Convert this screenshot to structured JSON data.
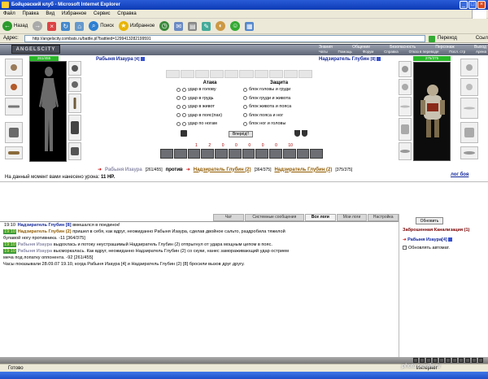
{
  "window": {
    "title": "Бойцовский клуб - Microsoft Internet Explorer"
  },
  "menu": [
    "Файл",
    "Правка",
    "Вид",
    "Избранное",
    "Сервис",
    "Справка"
  ],
  "toolbar": {
    "back": "Назад",
    "search": "Поиск",
    "favorites": "Избранное"
  },
  "address": {
    "label": "Адрес:",
    "url": "http://angelscity.combats.ru/battle.pl?battleid=1299413282199591",
    "go": "Переход",
    "links": "Ссылки"
  },
  "game": {
    "logo": "ANGELSCITY",
    "nav": [
      "Знания",
      "Общение",
      "Безопасность",
      "Персонаж",
      "Выход"
    ],
    "subnav": [
      "Чаты",
      "Помощь",
      "Форум",
      "Справка",
      "Отказ в переводе",
      "Посл. стр",
      "Арена"
    ]
  },
  "left_char": {
    "name": "Рабыня Изаура",
    "level": "[4]",
    "hp_current": "261",
    "hp_max": "455"
  },
  "right_char": {
    "name": "Надзиратель Глубин",
    "level": "[8]",
    "hp_current": "275",
    "hp_max": "375"
  },
  "combat": {
    "attack_head": "Атака",
    "defense_head": "Защита",
    "attack": [
      "удар в голову",
      "удар в грудь",
      "удар в живот",
      "удар в пояс(пах)",
      "удар по ногам"
    ],
    "defense": [
      "блок головы и груди",
      "блок груди и живота",
      "блок живота и пояса",
      "блок пояса и ног",
      "блок ног и головы"
    ],
    "button": "Вперёд!!",
    "powers": [
      "1",
      "2",
      "0",
      "0",
      "0",
      "0",
      "0",
      "10"
    ]
  },
  "fight_line": {
    "left_name": "Рабыня Изаура",
    "left_hp": "[261/455]",
    "vs": "против",
    "right_name": "Надзиратель Глубин (2)",
    "right_hp": "[364/375]",
    "right2_name": "Надзиратель Глубин (2)",
    "right2_hp": "[375/375]"
  },
  "log_link": "лог боя",
  "damage_line": {
    "text": "На данный момент вами нанесено урона:",
    "value": "11 HP."
  },
  "tabs": [
    "Чат",
    "Системные сообщения",
    "Все логи",
    "Мои логи",
    "Настройка"
  ],
  "active_tab": "Все логи",
  "chat": [
    {
      "time": "19:10",
      "who": "Надзиратель Глубин [8]",
      "text": "вмешался в поединок!"
    },
    {
      "time": "19:10",
      "who": "Надзиратель Глубин (2)",
      "text": "пришел в себя, как вдруг, неожиданно Рабыня Изаура, сделав двойное сальто, раздробила тяжелой"
    },
    {
      "time": "",
      "who": "",
      "text": "булавой ногу противника. -11 [364/375]"
    },
    {
      "time": "19:10",
      "who": "Рабыня Изаура",
      "text": "выдохлась и потоку неустрашимый Надзиратель Глубин (2) отпрыгнул от удара мощным цепом в пояс."
    },
    {
      "time": "19:10",
      "who": "Рабыня Изаура",
      "text": "высморкалась. Как вдруг, неожиданно Надзиратель Глубин (2) со скуки, нанес замораживающий удар острием"
    },
    {
      "time": "",
      "who": "",
      "text": "меча под лопатку оппонента. -92 [261/455]"
    },
    {
      "time": "",
      "who": "",
      "text": "Часы показывали 28.09.07 19.10, когда Рабыня Изаура [4] и Надзиратель Глубин (2) [8] бросили вызов друг другу."
    }
  ],
  "right_panel": {
    "refresh": "Обновить",
    "zone": "Заброшенная Канализация (1)",
    "member": "Рабыня Изаура[4]",
    "auto": "Обновлять автомат."
  },
  "status": {
    "left": "Готово",
    "zone": "Интернет"
  },
  "watermark": "photo.scrolls.ru"
}
